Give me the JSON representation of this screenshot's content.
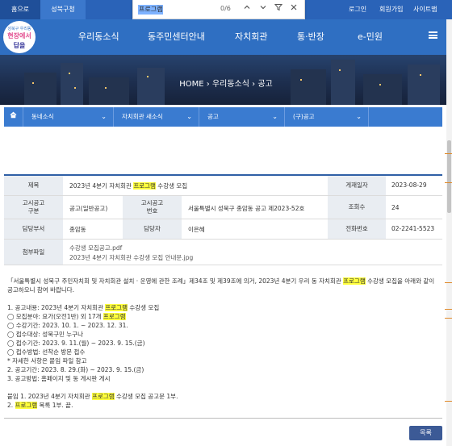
{
  "topbar": {
    "home_tab": "홈으로",
    "office_tab": "성북구청",
    "links": [
      "로그인",
      "회원가입",
      "사이트맵"
    ]
  },
  "findbar": {
    "query": "프로그램",
    "count": "0/6",
    "icons": [
      "chevron-up-icon",
      "chevron-down-icon",
      "filter-icon",
      "close-icon"
    ]
  },
  "logo": {
    "line1": "성북구 우리동",
    "line2": "현장에서",
    "line3": "답을"
  },
  "mainnav": {
    "items": [
      "우리동소식",
      "동주민센터안내",
      "자치회관",
      "통·반장",
      "e-민원"
    ]
  },
  "hero": {
    "breadcrumb": "HOME  ›  우리동소식  ›  공고"
  },
  "subnav": {
    "items": [
      "동네소식",
      "자치회관 새소식",
      "공고",
      "(구)공고"
    ]
  },
  "post": {
    "title_label": "제목",
    "title_before": "2023년 4분기 자치회관 ",
    "title_highlight": "프로그램",
    "title_after": " 수강생 모집",
    "date_label": "게재일자",
    "date": "2023-08-29",
    "type_label": "고시공고\n구분",
    "type": "공고(일반공고)",
    "number_label": "고시공고\n번호",
    "number": "서울특별시 성북구 종암동 공고 제2023-52호",
    "views_label": "조회수",
    "views": "24",
    "dept_label": "담당부서",
    "dept": "종암동",
    "person_label": "담당자",
    "person": "이은혜",
    "phone_label": "전화번호",
    "phone": "02-2241-5523",
    "attach_label": "첨부파일",
    "attachments": [
      "수강생 모집공고.pdf",
      "2023년 4분기 자치회관 수강생 모집 안내문.jpg"
    ]
  },
  "body_lines": [
    [
      "「서울특별시 성북구 주민자치회 및 자치회관 설치 · 운영에 관한 조례」제34조 및 제39조에 의거, 2023년 4분기 우리 동 자치회관 ",
      "프로그램",
      " 수강생 모집을 아래와 같이"
    ],
    [
      "공고하오니 참여 바랍니다.",
      "",
      ""
    ],
    [
      "",
      "",
      ""
    ],
    [
      "1. 공고내용: 2023년 4분기 자치회관 ",
      "프로그램",
      " 수강생 모집"
    ],
    [
      "◯ 모집분야: 요가(오전1반) 외 17개 ",
      "프로그램",
      ""
    ],
    [
      "◯ 수강기간: 2023. 10. 1. ~ 2023. 12. 31.",
      "",
      ""
    ],
    [
      "◯ 접수대상: 성북구민 누구나",
      "",
      ""
    ],
    [
      "◯ 접수기간: 2023. 9. 11.(월) ~ 2023. 9. 15.(금)",
      "",
      ""
    ],
    [
      "◯ 접수방법: 선착순 방문 접수",
      "",
      ""
    ],
    [
      "* 자세한 사항은 붙임 파일 참고",
      "",
      ""
    ],
    [
      "2. 공고기간: 2023. 8. 29.(화) ~ 2023. 9. 15.(금)",
      "",
      ""
    ],
    [
      "3. 공고방법: 홈페이지 및 동 게시판 게시",
      "",
      ""
    ],
    [
      "",
      "",
      ""
    ],
    [
      "붙임 1. 2023년 4분기 자치회관 ",
      "프로그램",
      " 수강생 모집 공고문 1부."
    ],
    [
      "2. ",
      "프로그램",
      " 목록 1부. 끝."
    ]
  ],
  "list_button": "목록",
  "colors": {
    "brand": "#2f6fc2",
    "highlight": "#ffff3d",
    "button": "#3c5a96"
  }
}
